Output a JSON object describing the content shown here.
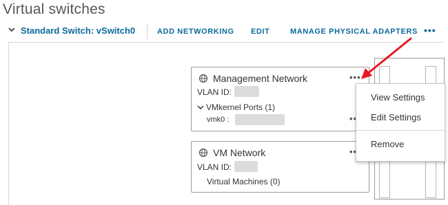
{
  "page": {
    "title": "Virtual switches"
  },
  "toolbar": {
    "switch_name": "Standard Switch: vSwitch0",
    "add_networking": "ADD NETWORKING",
    "edit": "EDIT",
    "manage_adapters": "MANAGE PHYSICAL ADAPTERS",
    "more": "•••"
  },
  "cards": {
    "management": {
      "title": "Management Network",
      "vlan_label": "VLAN ID:",
      "ports_label": "VMkernel Ports (1)",
      "vmk_label": "vmk0 :",
      "more": "•••"
    },
    "vm_network": {
      "title": "VM Network",
      "vlan_label": "VLAN ID:",
      "vms_label": "Virtual Machines (0)",
      "more": "•••"
    }
  },
  "context_menu": {
    "items": [
      "View Settings",
      "Edit Settings",
      "Remove"
    ]
  },
  "colors": {
    "link_blue": "#0b6a9c",
    "annotation_red": "#e8191e"
  },
  "icons": [
    "chevron-down-icon",
    "network-globe-icon",
    "chevron-down-icon",
    "more-icon",
    "red-arrow-icon"
  ]
}
